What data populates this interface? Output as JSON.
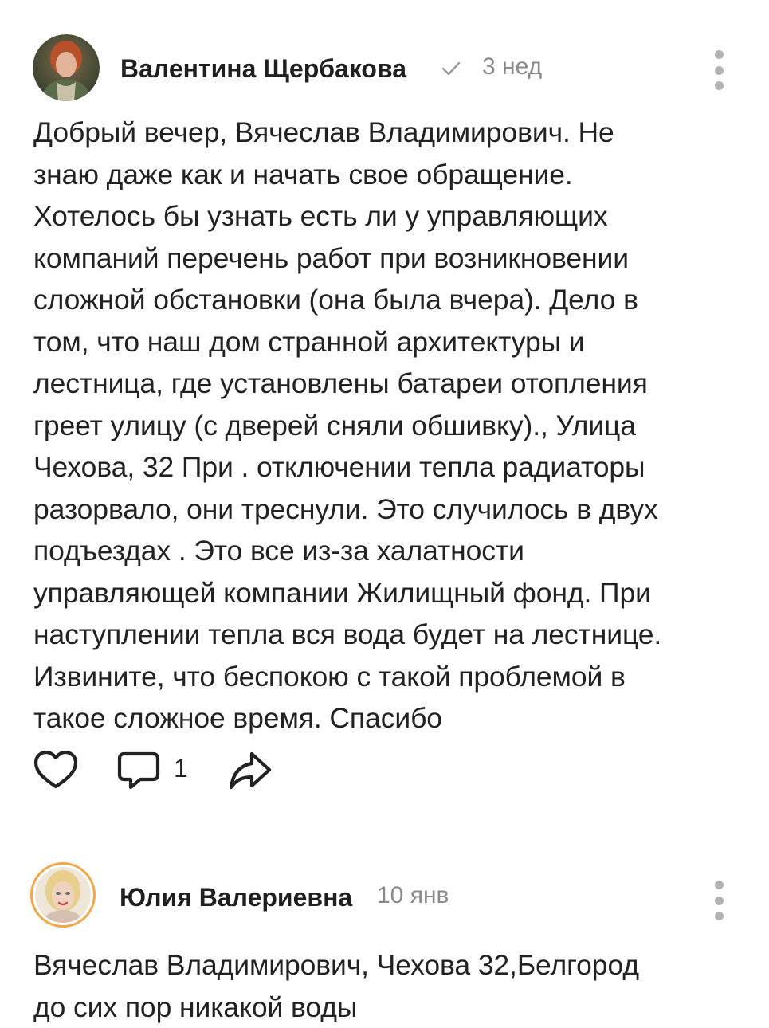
{
  "posts": [
    {
      "author": "Валентина Щербакова",
      "verified_icon": "check-icon",
      "time": "3 нед",
      "lines": [
        "Добрый вечер, Вячеслав Владимирович. Не",
        "знаю даже как и начать свое обращение.",
        "Хотелось бы узнать есть ли у управляющих",
        "компаний перечень работ при возникновении",
        "сложной обстановки (она была вчера). Дело в",
        "том, что наш дом странной архитектуры и",
        "лестница, где установлены батареи отопления",
        "греет улицу (с дверей сняли обшивку)., Улица",
        "Чехова, 32 При . отключении тепла радиаторы",
        "разорвало, они треснули. Это случилось в двух",
        "подъездах . Это все из-за халатности",
        "управляющей компании Жилищный фонд. При",
        "наступлении тепла вся вода будет на лестнице.",
        "Извините, что беспокою с такой проблемой в",
        "такое сложное время. Спасибо"
      ],
      "actions": {
        "like_icon": "heart-icon",
        "comment_icon": "comment-bubble-icon",
        "comment_count": "1",
        "share_icon": "share-arrow-icon"
      }
    },
    {
      "author": "Юлия Валериевна",
      "time": "10 янв",
      "lines": [
        "Вячеслав Владимирович, Чехова 32,Белгород",
        "до сих пор никакой воды"
      ]
    }
  ],
  "more_icon": "more-vertical-icon",
  "colors": {
    "text": "#222222",
    "meta": "#8a8a8a",
    "dots": "#b3b3b3",
    "story_ring": "#f0a848"
  }
}
